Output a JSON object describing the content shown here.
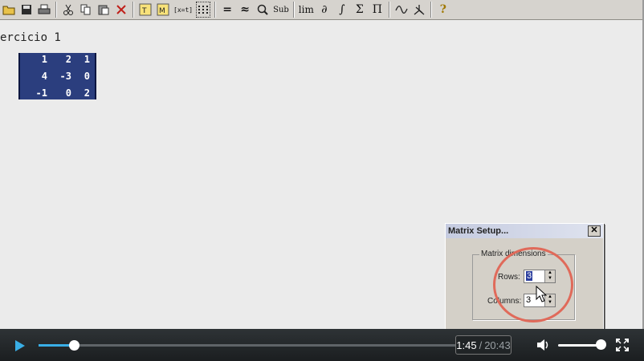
{
  "toolbar": {
    "buttons": [
      {
        "icon": "open-folder-icon",
        "label": ""
      },
      {
        "icon": "save-icon",
        "label": ""
      },
      {
        "icon": "print-icon",
        "label": ""
      },
      {
        "icon": "cut-icon",
        "label": ""
      },
      {
        "icon": "copy-icon",
        "label": ""
      },
      {
        "icon": "paste-icon",
        "label": ""
      },
      {
        "icon": "delete-icon",
        "label": ""
      },
      {
        "icon": "insert-text-icon",
        "label": ""
      },
      {
        "icon": "insert-math-icon",
        "label": ""
      },
      {
        "icon": "insert-text-math-icon",
        "label": "[x=t]"
      },
      {
        "icon": "matrix-icon",
        "label": ""
      },
      {
        "icon": "equals-icon",
        "label": "="
      },
      {
        "icon": "approx-icon",
        "label": "≈"
      },
      {
        "icon": "zoom-icon",
        "label": ""
      },
      {
        "icon": "substitute-icon",
        "label": "Sub"
      },
      {
        "icon": "limit-icon",
        "label": "lim"
      },
      {
        "icon": "derivative-icon",
        "label": "∂"
      },
      {
        "icon": "integral-icon",
        "label": "∫"
      },
      {
        "icon": "sum-icon",
        "label": "Σ"
      },
      {
        "icon": "product-icon",
        "label": "Π"
      },
      {
        "icon": "plot-2d-icon",
        "label": ""
      },
      {
        "icon": "plot-3d-icon",
        "label": ""
      },
      {
        "icon": "help-icon",
        "label": "?"
      }
    ]
  },
  "worksheet": {
    "title": "ercicio 1",
    "matrix": [
      [
        "1",
        "2",
        "1"
      ],
      [
        "4",
        "-3",
        "0"
      ],
      [
        "-1",
        "0",
        "2"
      ]
    ]
  },
  "dialog": {
    "title": "Matrix Setup...",
    "close_label": "✕",
    "group_label": "Matrix dimensions",
    "rows_label": "Rows:",
    "rows_value": "3",
    "columns_label": "Columns:",
    "columns_value": "3"
  },
  "player": {
    "current_time": "1:45",
    "separator": "/",
    "duration": "20:43",
    "progress_fraction": 0.0845,
    "volume_fraction": 0.85,
    "accent_color": "#39aee6"
  }
}
